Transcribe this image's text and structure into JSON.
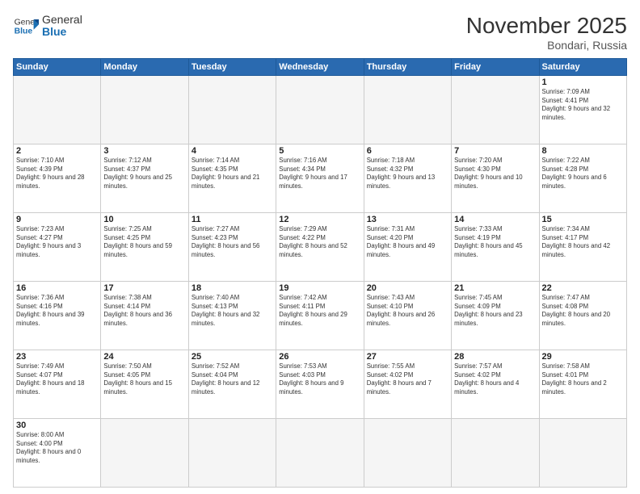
{
  "header": {
    "logo_general": "General",
    "logo_blue": "Blue",
    "month_title": "November 2025",
    "location": "Bondari, Russia"
  },
  "days_of_week": [
    "Sunday",
    "Monday",
    "Tuesday",
    "Wednesday",
    "Thursday",
    "Friday",
    "Saturday"
  ],
  "weeks": [
    [
      {
        "day": "",
        "empty": true
      },
      {
        "day": "",
        "empty": true
      },
      {
        "day": "",
        "empty": true
      },
      {
        "day": "",
        "empty": true
      },
      {
        "day": "",
        "empty": true
      },
      {
        "day": "",
        "empty": true
      },
      {
        "day": "1",
        "sunrise": "7:09 AM",
        "sunset": "4:41 PM",
        "daylight": "9 hours and 32 minutes."
      }
    ],
    [
      {
        "day": "2",
        "sunrise": "7:10 AM",
        "sunset": "4:39 PM",
        "daylight": "9 hours and 28 minutes."
      },
      {
        "day": "3",
        "sunrise": "7:12 AM",
        "sunset": "4:37 PM",
        "daylight": "9 hours and 25 minutes."
      },
      {
        "day": "4",
        "sunrise": "7:14 AM",
        "sunset": "4:35 PM",
        "daylight": "9 hours and 21 minutes."
      },
      {
        "day": "5",
        "sunrise": "7:16 AM",
        "sunset": "4:34 PM",
        "daylight": "9 hours and 17 minutes."
      },
      {
        "day": "6",
        "sunrise": "7:18 AM",
        "sunset": "4:32 PM",
        "daylight": "9 hours and 13 minutes."
      },
      {
        "day": "7",
        "sunrise": "7:20 AM",
        "sunset": "4:30 PM",
        "daylight": "9 hours and 10 minutes."
      },
      {
        "day": "8",
        "sunrise": "7:22 AM",
        "sunset": "4:28 PM",
        "daylight": "9 hours and 6 minutes."
      }
    ],
    [
      {
        "day": "9",
        "sunrise": "7:23 AM",
        "sunset": "4:27 PM",
        "daylight": "9 hours and 3 minutes."
      },
      {
        "day": "10",
        "sunrise": "7:25 AM",
        "sunset": "4:25 PM",
        "daylight": "8 hours and 59 minutes."
      },
      {
        "day": "11",
        "sunrise": "7:27 AM",
        "sunset": "4:23 PM",
        "daylight": "8 hours and 56 minutes."
      },
      {
        "day": "12",
        "sunrise": "7:29 AM",
        "sunset": "4:22 PM",
        "daylight": "8 hours and 52 minutes."
      },
      {
        "day": "13",
        "sunrise": "7:31 AM",
        "sunset": "4:20 PM",
        "daylight": "8 hours and 49 minutes."
      },
      {
        "day": "14",
        "sunrise": "7:33 AM",
        "sunset": "4:19 PM",
        "daylight": "8 hours and 45 minutes."
      },
      {
        "day": "15",
        "sunrise": "7:34 AM",
        "sunset": "4:17 PM",
        "daylight": "8 hours and 42 minutes."
      }
    ],
    [
      {
        "day": "16",
        "sunrise": "7:36 AM",
        "sunset": "4:16 PM",
        "daylight": "8 hours and 39 minutes."
      },
      {
        "day": "17",
        "sunrise": "7:38 AM",
        "sunset": "4:14 PM",
        "daylight": "8 hours and 36 minutes."
      },
      {
        "day": "18",
        "sunrise": "7:40 AM",
        "sunset": "4:13 PM",
        "daylight": "8 hours and 32 minutes."
      },
      {
        "day": "19",
        "sunrise": "7:42 AM",
        "sunset": "4:11 PM",
        "daylight": "8 hours and 29 minutes."
      },
      {
        "day": "20",
        "sunrise": "7:43 AM",
        "sunset": "4:10 PM",
        "daylight": "8 hours and 26 minutes."
      },
      {
        "day": "21",
        "sunrise": "7:45 AM",
        "sunset": "4:09 PM",
        "daylight": "8 hours and 23 minutes."
      },
      {
        "day": "22",
        "sunrise": "7:47 AM",
        "sunset": "4:08 PM",
        "daylight": "8 hours and 20 minutes."
      }
    ],
    [
      {
        "day": "23",
        "sunrise": "7:49 AM",
        "sunset": "4:07 PM",
        "daylight": "8 hours and 18 minutes."
      },
      {
        "day": "24",
        "sunrise": "7:50 AM",
        "sunset": "4:05 PM",
        "daylight": "8 hours and 15 minutes."
      },
      {
        "day": "25",
        "sunrise": "7:52 AM",
        "sunset": "4:04 PM",
        "daylight": "8 hours and 12 minutes."
      },
      {
        "day": "26",
        "sunrise": "7:53 AM",
        "sunset": "4:03 PM",
        "daylight": "8 hours and 9 minutes."
      },
      {
        "day": "27",
        "sunrise": "7:55 AM",
        "sunset": "4:02 PM",
        "daylight": "8 hours and 7 minutes."
      },
      {
        "day": "28",
        "sunrise": "7:57 AM",
        "sunset": "4:02 PM",
        "daylight": "8 hours and 4 minutes."
      },
      {
        "day": "29",
        "sunrise": "7:58 AM",
        "sunset": "4:01 PM",
        "daylight": "8 hours and 2 minutes."
      }
    ],
    [
      {
        "day": "30",
        "sunrise": "8:00 AM",
        "sunset": "4:00 PM",
        "daylight": "8 hours and 0 minutes."
      },
      {
        "day": "",
        "empty": true
      },
      {
        "day": "",
        "empty": true
      },
      {
        "day": "",
        "empty": true
      },
      {
        "day": "",
        "empty": true
      },
      {
        "day": "",
        "empty": true
      },
      {
        "day": "",
        "empty": true
      }
    ]
  ]
}
